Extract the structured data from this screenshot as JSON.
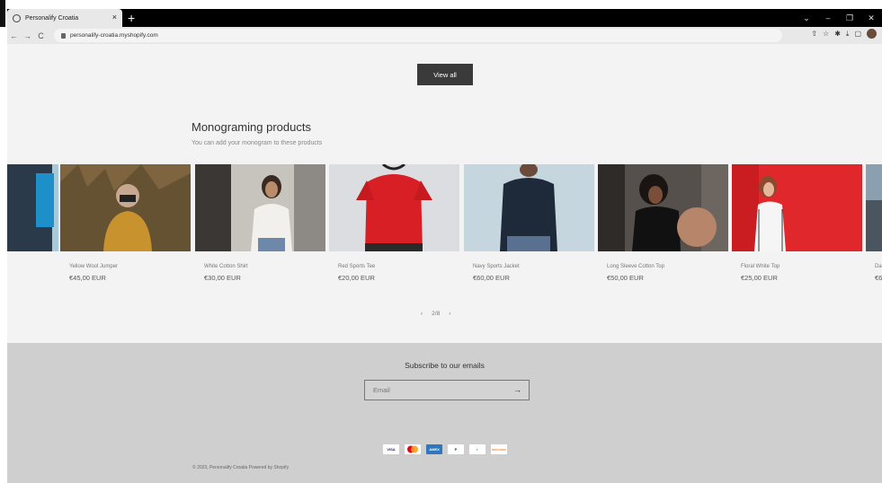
{
  "browser": {
    "tab_title": "Personalify Croatia",
    "new_tab": "+",
    "tab_close": "×",
    "url": "personalify-croatia.myshopify.com",
    "nav": {
      "back": "←",
      "forward": "→",
      "reload": "C"
    },
    "window_controls": {
      "chevron": "⌄",
      "minimize": "–",
      "restore": "❐",
      "close": "✕"
    }
  },
  "page": {
    "view_all_label": "View all",
    "section_title": "Monograming products",
    "section_subtitle": "You can add your monogram to these products",
    "products": [
      {
        "name": "",
        "price": "",
        "scene": "partial-blue-jacket"
      },
      {
        "name": "Yellow Wool Jumper",
        "price": "€45,00 EUR",
        "scene": "cornfield-camera"
      },
      {
        "name": "White Cotton Shirt",
        "price": "€30,00 EUR",
        "scene": "street-white-shirt"
      },
      {
        "name": "Red Sports Tee",
        "price": "€20,00 EUR",
        "scene": "red-tee"
      },
      {
        "name": "Navy Sports Jacket",
        "price": "€60,00 EUR",
        "scene": "navy-jacket-back"
      },
      {
        "name": "Long Sleeve Cotton Top",
        "price": "€50,00 EUR",
        "scene": "black-top-ball"
      },
      {
        "name": "Floral White Top",
        "price": "€25,00 EUR",
        "scene": "red-wall-floral"
      },
      {
        "name": "Da",
        "price": "€6",
        "scene": "partial-street"
      }
    ],
    "pager": {
      "prev": "‹",
      "text": "2/8",
      "next": "›"
    }
  },
  "footer": {
    "subscribe_title": "Subscribe to our emails",
    "email_placeholder": "Email",
    "submit_arrow": "→",
    "payment_methods": [
      "VISA",
      "MC",
      "AMEX",
      "PayPal",
      "Diners",
      "DISCOVER"
    ],
    "copyright": "© 2023, Personalify Croatia Powered by Shopify"
  },
  "colors": {
    "page_bg": "#f3f3f3",
    "footer_bg": "#cfcfcf",
    "button_bg": "#3a3a3a"
  }
}
